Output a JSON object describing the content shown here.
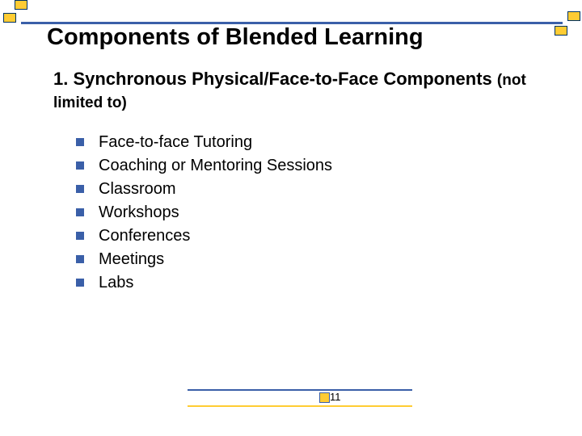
{
  "title": "Components of Blended Learning",
  "subtitle_main": "1. Synchronous Physical/Face-to-Face Components",
  "subtitle_note": "(not limited to)",
  "bullets": [
    "Face-to-face Tutoring",
    "Coaching or Mentoring Sessions",
    "Classroom",
    "Workshops",
    "Conferences",
    "Meetings",
    "Labs"
  ],
  "page_number": "11"
}
